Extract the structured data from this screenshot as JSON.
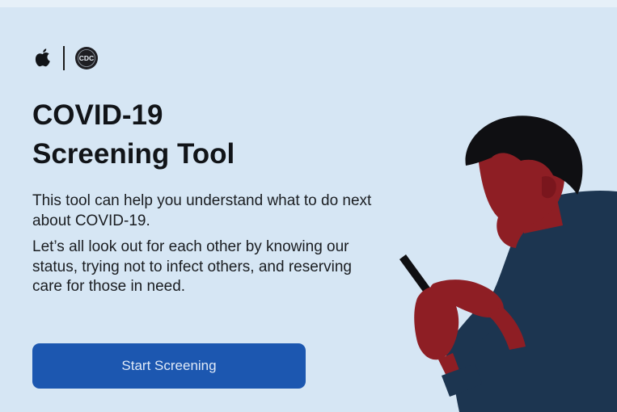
{
  "header": {
    "logos": [
      {
        "name": "apple-icon"
      },
      {
        "name": "cdc-logo-icon",
        "text": "CDC"
      }
    ]
  },
  "main": {
    "title_line1": "COVID-19",
    "title_line2": "Screening Tool",
    "description_1": "This tool can help you understand what to do next about COVID-19.",
    "description_2": "Let’s all look out for each other by knowing our status, trying not to infect others, and reserving care for those in need.",
    "start_button_label": "Start Screening"
  },
  "colors": {
    "background": "#d6e6f4",
    "button": "#1c57b0",
    "button_text": "#dfe9f7",
    "title_text": "#111418",
    "illustration_skin": "#8e1e24",
    "illustration_shirt": "#1c3550",
    "illustration_hair": "#0f0f12"
  }
}
